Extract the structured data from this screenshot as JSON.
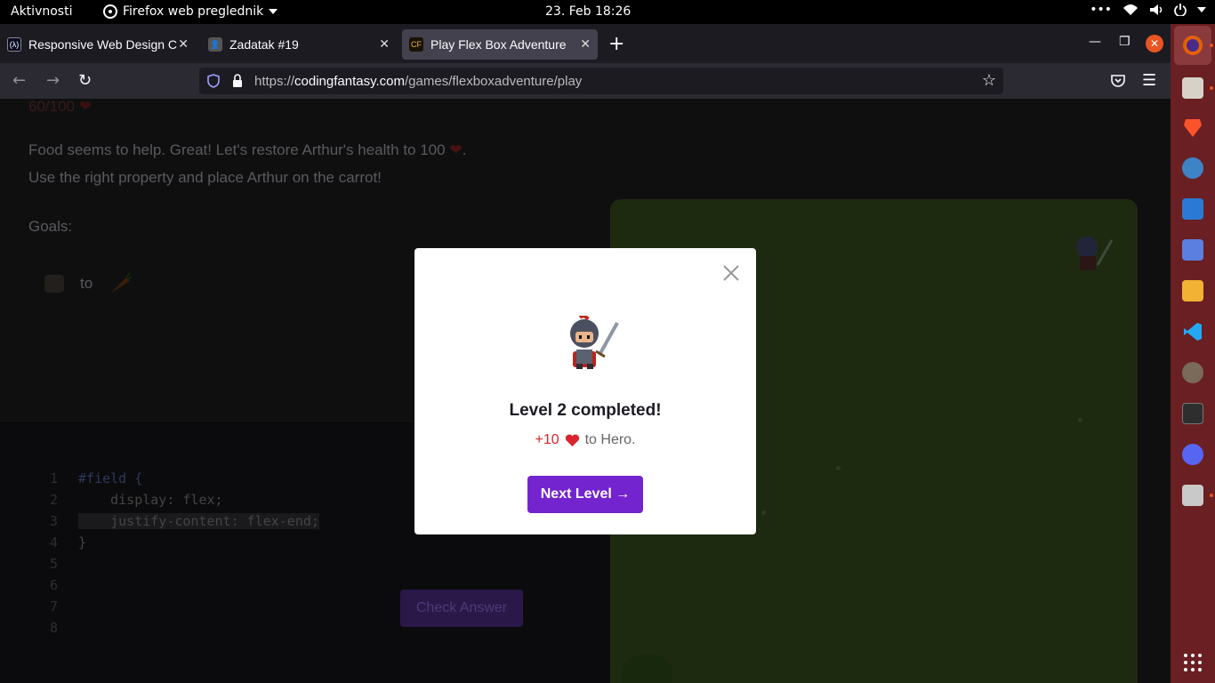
{
  "topbar": {
    "activities": "Aktivnosti",
    "app_menu": "Firefox web preglednik",
    "clock": "23. Feb  18:26",
    "tray_icons": [
      "menu-dots-icon",
      "wifi-icon",
      "volume-icon",
      "power-icon"
    ]
  },
  "tabs": [
    {
      "title": "Responsive Web Design C",
      "icon": "fcc-icon",
      "active": false
    },
    {
      "title": "Zadatak #19",
      "icon": "user-icon",
      "active": false
    },
    {
      "title": "Play Flex Box Adventure",
      "icon": "cf-icon",
      "active": true
    }
  ],
  "urlbar": {
    "scheme": "https://",
    "host": "codingfantasy.com",
    "path": "/games/flexboxadventure/play"
  },
  "page": {
    "health": "60/100",
    "line1": "Food seems to help. Great! Let's restore Arthur's health to 100",
    "line1_end": ".",
    "line2": "Use the right property and place Arthur on the carrot!",
    "goals_label": "Goals:",
    "goal_to": "to",
    "code": [
      {
        "n": "1",
        "text": "#field {"
      },
      {
        "n": "2",
        "text": "    display: flex;"
      },
      {
        "n": "3",
        "text": "    justify-content: flex-end;"
      },
      {
        "n": "4",
        "text": "}"
      },
      {
        "n": "5",
        "text": ""
      },
      {
        "n": "6",
        "text": ""
      },
      {
        "n": "7",
        "text": ""
      },
      {
        "n": "8",
        "text": ""
      }
    ],
    "check_button": "Check Answer"
  },
  "modal": {
    "heading": "Level 2 completed!",
    "reward_plus": "+10",
    "reward_suffix": "to Hero.",
    "next_button": "Next Level →"
  },
  "colors": {
    "accent": "#7324cf",
    "heart": "#d9252b",
    "dock": "#6a1f22",
    "close_window": "#e95420"
  },
  "dock": [
    "firefox-icon",
    "files-icon",
    "brave-icon",
    "screenshot-icon",
    "writer-icon",
    "screen-select-icon",
    "calculator-icon",
    "vscode-icon",
    "gimp-icon",
    "terminal-icon",
    "discord-icon",
    "image-viewer-icon",
    "app-grid-icon"
  ]
}
